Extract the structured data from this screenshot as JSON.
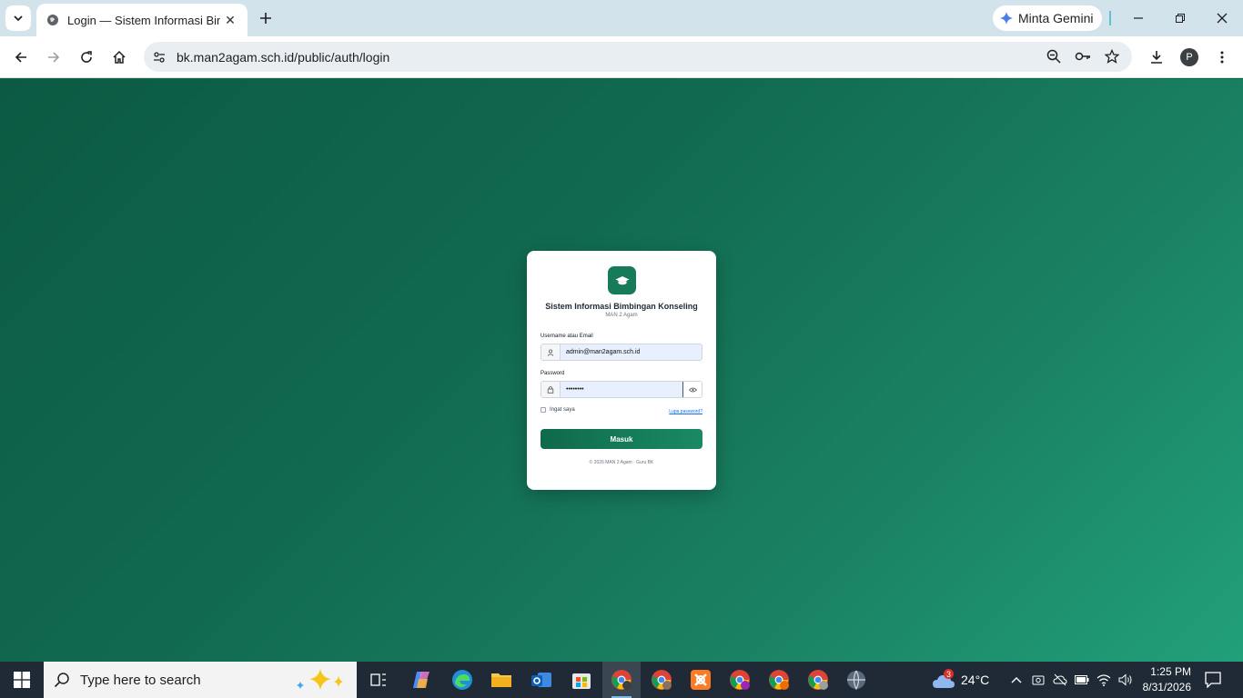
{
  "browser": {
    "tab_title": "Login — Sistem Informasi Bimbingan Konseling",
    "tab_close": "✕",
    "gemini_label": "Minta Gemini",
    "url": "bk.man2agam.sch.id/public/auth/login",
    "profile_initial": "P"
  },
  "login": {
    "title": "Sistem Informasi Bimbingan Konseling",
    "subtitle": "MAN 2 Agam",
    "username_label": "Username atau Email",
    "username_value": "admin@man2agam.sch.id",
    "password_label": "Password",
    "password_value": "••••••••",
    "remember_label": "Ingat saya",
    "forgot_label": "Lupa password?",
    "submit_label": "Masuk",
    "footer": "© 2026 MAN 2 Agam · Guru BK"
  },
  "taskbar": {
    "search_placeholder": "Type here to search",
    "weather_temp": "24°C",
    "weather_badge": "3",
    "time": "1:25 PM",
    "date": "8/31/2026"
  },
  "colors": {
    "brand": "#177a58",
    "background_start": "#0c5a43",
    "background_end": "#21a07a"
  }
}
